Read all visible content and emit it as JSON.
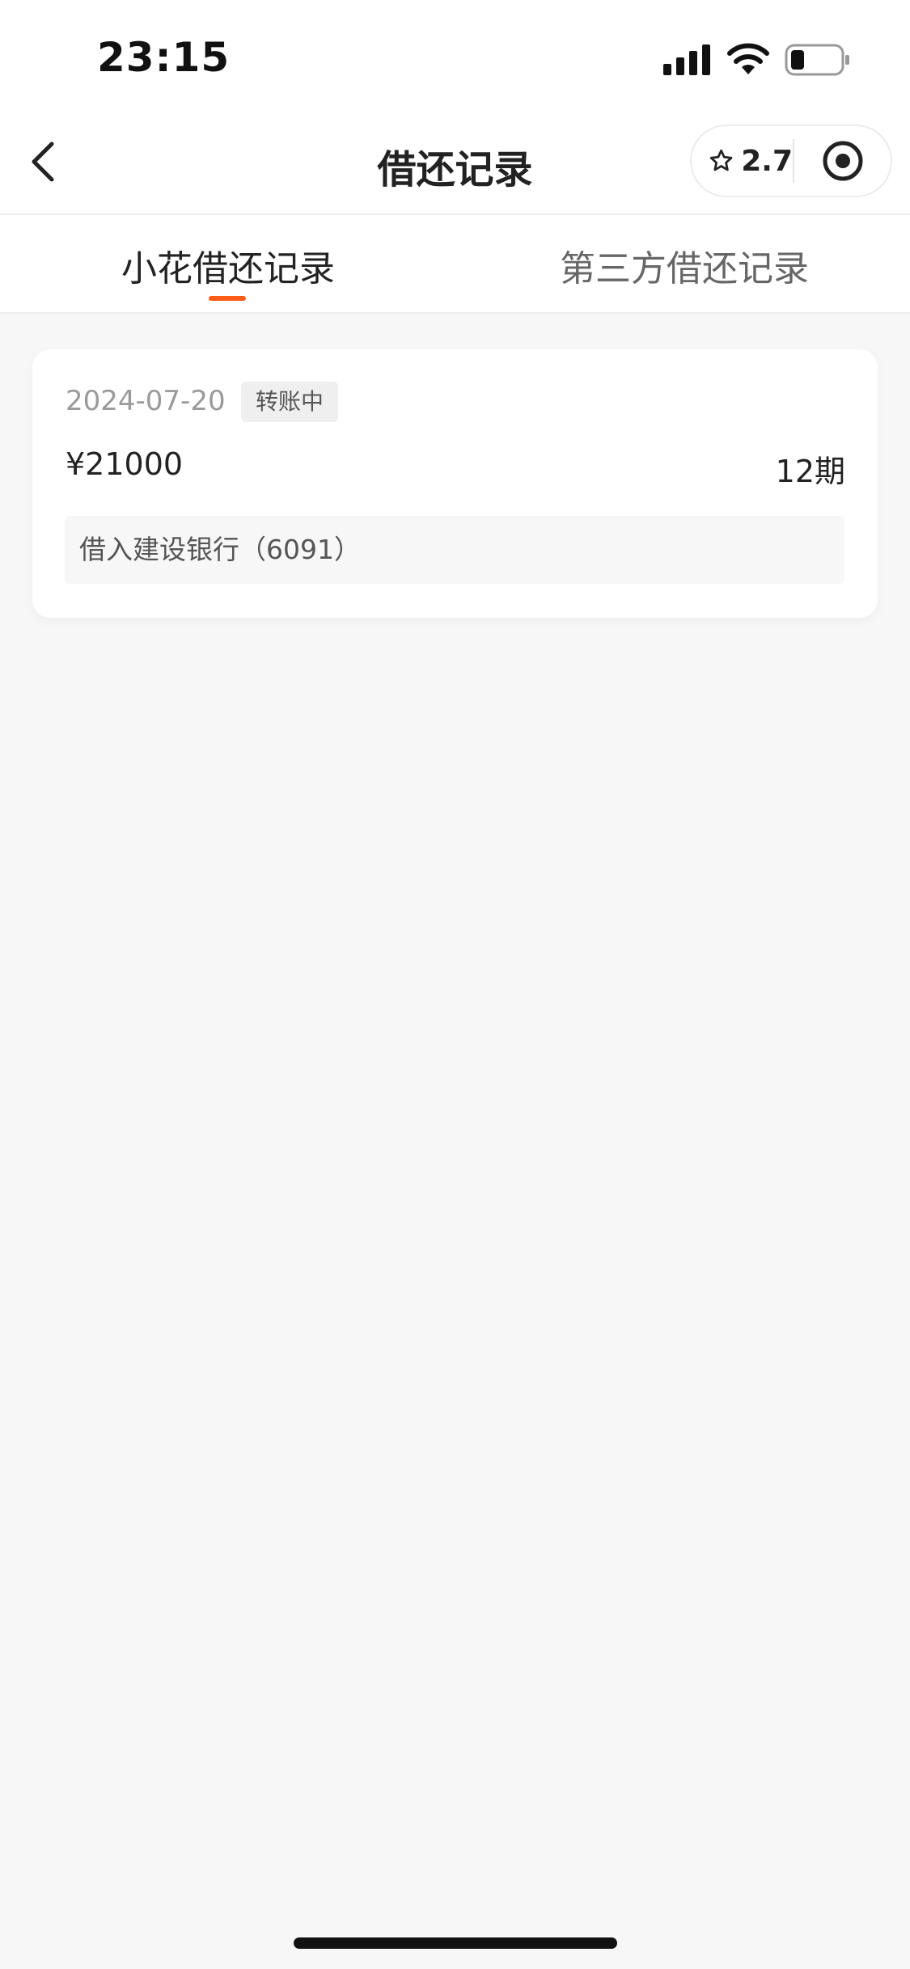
{
  "status_bar": {
    "time": "23:15",
    "icons": [
      "signal-icon",
      "wifi-icon",
      "battery-icon"
    ]
  },
  "nav": {
    "title": "借还记录",
    "back_icon": "chevron-left-icon",
    "capsule": {
      "rating_icon": "star-icon",
      "rating_value": "2.7",
      "target_icon": "target-icon"
    }
  },
  "tabs": [
    {
      "label": "小花借还记录",
      "active": true
    },
    {
      "label": "第三方借还记录",
      "active": false
    }
  ],
  "records": [
    {
      "date": "2024-07-20",
      "status": "转账中",
      "amount": "¥21000",
      "periods": "12期",
      "account": "借入建设银行（6091）"
    }
  ],
  "colors": {
    "accent": "#ff5c1a",
    "page_background": "#f7f7f7",
    "card_background": "#ffffff",
    "muted_text": "#9a9a9a"
  }
}
